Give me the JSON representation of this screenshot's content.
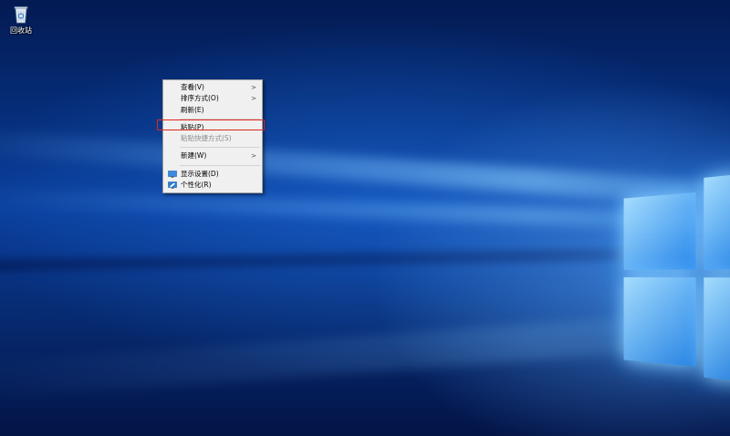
{
  "desktop": {
    "icons": [
      {
        "label": "回收站",
        "icon": "recycle-bin-icon"
      }
    ]
  },
  "context_menu": {
    "items": [
      {
        "label": "查看(V)",
        "submenu": true,
        "enabled": true
      },
      {
        "label": "排序方式(O)",
        "submenu": true,
        "enabled": true
      },
      {
        "label": "刷新(E)",
        "submenu": false,
        "enabled": true
      },
      {
        "separator": true
      },
      {
        "label": "粘贴(P)",
        "submenu": false,
        "enabled": true,
        "highlighted": true
      },
      {
        "label": "粘贴快捷方式(S)",
        "submenu": false,
        "enabled": false
      },
      {
        "separator": true
      },
      {
        "label": "新建(W)",
        "submenu": true,
        "enabled": true
      },
      {
        "separator": true
      },
      {
        "label": "显示设置(D)",
        "icon": "display-settings-icon",
        "enabled": true
      },
      {
        "label": "个性化(R)",
        "icon": "personalize-icon",
        "enabled": true
      }
    ],
    "submenu_arrow": ">"
  },
  "annotation": {
    "highlight_color": "#e0261f"
  }
}
